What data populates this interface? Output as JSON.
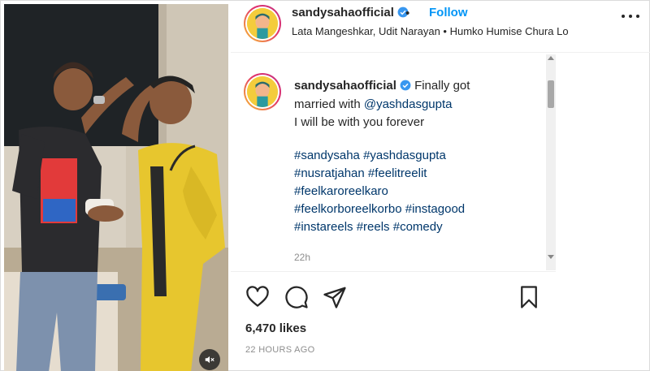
{
  "header": {
    "username": "sandysahaofficial",
    "separator": "•",
    "follow_label": "Follow",
    "audio": "Lata Mangeshkar, Udit Narayan • Humko Humise Chura Lo"
  },
  "caption": {
    "username": "sandysahaofficial",
    "lines": [
      "Finally got",
      "married with",
      "I will be with you forever",
      "#sandysaha #yashdasgupta",
      "#nusratjahan #feelitreelit",
      "#feelkaroreelkaro",
      "#feelkorboreelkorbo #instagood",
      "#instareels #reels #comedy"
    ],
    "mention": "@yashdasgupta",
    "time": "22h"
  },
  "actions": {
    "likes": "6,470 likes",
    "time_ago": "22 HOURS AGO"
  },
  "icons": {
    "verified": "verified-badge-icon",
    "like": "heart-icon",
    "comment": "comment-bubble-icon",
    "share": "paper-plane-icon",
    "save": "bookmark-icon",
    "more": "more-options-icon",
    "mute": "speaker-muted-icon"
  },
  "colors": {
    "accent": "#0095f6",
    "link": "#00376b",
    "verified": "#3897f0",
    "muted_text": "#8e8e8e"
  }
}
